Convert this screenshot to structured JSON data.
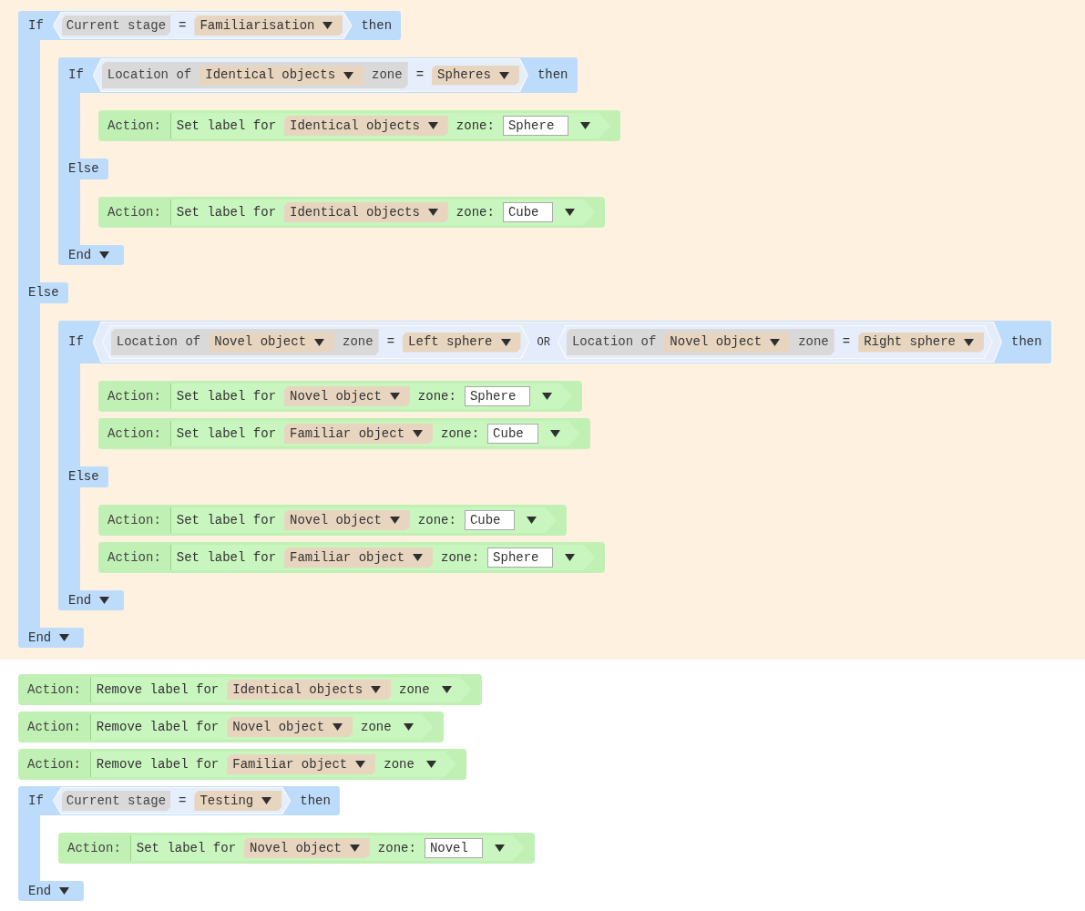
{
  "program": [
    {
      "kind": "if",
      "highlighted": true,
      "keyword": "If",
      "condition": {
        "kind": "compare",
        "left": {
          "kind": "variable",
          "label": "Current stage"
        },
        "operator": "=",
        "right": "Familiarisation"
      },
      "then_word": "then",
      "then": [
        {
          "kind": "if",
          "keyword": "If",
          "condition": {
            "kind": "compare",
            "left": {
              "kind": "location",
              "prefix": "Location of",
              "object": "Identical objects",
              "suffix": "zone"
            },
            "operator": "=",
            "right": "Spheres"
          },
          "then_word": "then",
          "then": [
            {
              "kind": "set_label",
              "label": "Action:",
              "verb": "Set label for",
              "object": "Identical objects",
              "zone_label": "zone:",
              "value": "Sphere"
            }
          ],
          "else_word": "Else",
          "else": [
            {
              "kind": "set_label",
              "label": "Action:",
              "verb": "Set label for",
              "object": "Identical objects",
              "zone_label": "zone:",
              "value": "Cube"
            }
          ],
          "end": "End"
        }
      ],
      "else_word": "Else",
      "else": [
        {
          "kind": "if",
          "keyword": "If",
          "condition": {
            "kind": "or",
            "operator": "OR",
            "terms": [
              {
                "kind": "compare",
                "left": {
                  "kind": "location",
                  "prefix": "Location of",
                  "object": "Novel object",
                  "suffix": "zone"
                },
                "operator": "=",
                "right": "Left sphere"
              },
              {
                "kind": "compare",
                "left": {
                  "kind": "location",
                  "prefix": "Location of",
                  "object": "Novel object",
                  "suffix": "zone"
                },
                "operator": "=",
                "right": "Right sphere"
              }
            ]
          },
          "then_word": "then",
          "then": [
            {
              "kind": "set_label",
              "label": "Action:",
              "verb": "Set label for",
              "object": "Novel object",
              "zone_label": "zone:",
              "value": "Sphere"
            },
            {
              "kind": "set_label",
              "label": "Action:",
              "verb": "Set label for",
              "object": "Familiar object",
              "zone_label": "zone:",
              "value": "Cube"
            }
          ],
          "else_word": "Else",
          "else": [
            {
              "kind": "set_label",
              "label": "Action:",
              "verb": "Set label for",
              "object": "Novel object",
              "zone_label": "zone:",
              "value": "Cube"
            },
            {
              "kind": "set_label",
              "label": "Action:",
              "verb": "Set label for",
              "object": "Familiar object",
              "zone_label": "zone:",
              "value": "Sphere"
            }
          ],
          "end": "End"
        }
      ],
      "end": "End"
    },
    {
      "kind": "remove_label",
      "highlighted": false,
      "label": "Action:",
      "verb": "Remove label for",
      "object": "Identical objects",
      "zone_label": "zone"
    },
    {
      "kind": "remove_label",
      "highlighted": false,
      "label": "Action:",
      "verb": "Remove label for",
      "object": "Novel object",
      "zone_label": "zone"
    },
    {
      "kind": "remove_label",
      "highlighted": false,
      "label": "Action:",
      "verb": "Remove label for",
      "object": "Familiar object",
      "zone_label": "zone"
    },
    {
      "kind": "if",
      "highlighted": false,
      "keyword": "If",
      "condition": {
        "kind": "compare",
        "left": {
          "kind": "variable",
          "label": "Current stage"
        },
        "operator": "=",
        "right": "Testing"
      },
      "then_word": "then",
      "then": [
        {
          "kind": "set_label",
          "label": "Action:",
          "verb": "Set label for",
          "object": "Novel object",
          "zone_label": "zone:",
          "value": "Novel"
        }
      ],
      "end": "End"
    }
  ]
}
